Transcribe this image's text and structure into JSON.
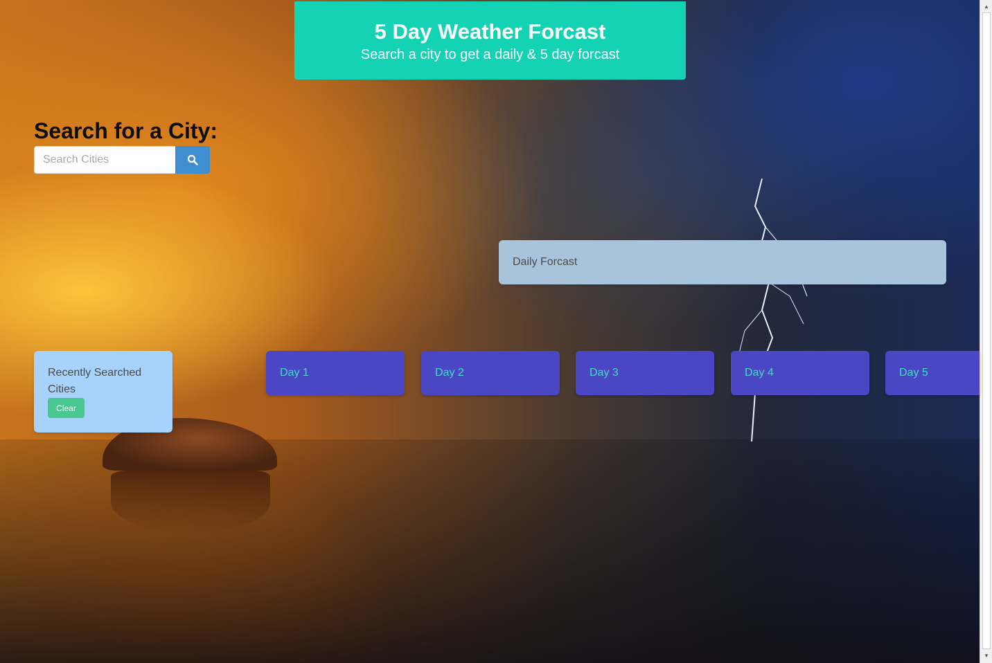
{
  "hero": {
    "title": "5 Day Weather Forcast",
    "subtitle": "Search a city to get a daily & 5 day forcast"
  },
  "search": {
    "heading": "Search for a City:",
    "placeholder": "Search Cities",
    "button_icon": "search-icon"
  },
  "daily": {
    "label": "Daily Forcast"
  },
  "recent": {
    "title": "Recently Searched Cities",
    "clear_label": "Clear"
  },
  "forecast": {
    "days": [
      {
        "label": "Day 1"
      },
      {
        "label": "Day 2"
      },
      {
        "label": "Day 3"
      },
      {
        "label": "Day 4"
      },
      {
        "label": "Day 5"
      }
    ]
  },
  "colors": {
    "hero": "#14d2b4",
    "search_button": "#3e8ed0",
    "daily_box": "#a8c4dc",
    "recent_box": "#a6d2fb",
    "clear_button": "#48c78e",
    "day_card": "#4a46c4",
    "day_text": "#45dbc8"
  }
}
